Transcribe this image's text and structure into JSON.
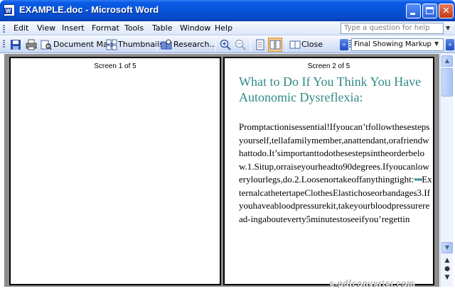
{
  "window": {
    "title": "EXAMPLE.doc - Microsoft Word",
    "app_icon_letter": "W",
    "controls": [
      "minimize",
      "maximize",
      "close"
    ]
  },
  "menu": {
    "items": [
      "Edit",
      "View",
      "Insert",
      "Format",
      "Tools",
      "Table",
      "Window",
      "Help"
    ],
    "help_placeholder": "Type a question for help"
  },
  "toolbar": {
    "document_map": "Document Map",
    "thumbnails": "Thumbnails",
    "research": "Research...",
    "close": "Close",
    "markup_mode": "Final Showing Markup"
  },
  "pages": {
    "left_label": "Screen 1 of 5",
    "right_label": "Screen 2 of 5"
  },
  "document": {
    "heading_line1": "What to Do If You Think You Have",
    "heading_line2": "Autonomic Dysreflexia:",
    "body_part1": "Promptactionisessential!Ifyoucan’tfollowthesestepsyourself,tellafamilymember,anattendant,orafriendwhattodo.It’simportanttodothesestepsintheorderbelow.1.Situp,orraiseyourheadto90degrees.Ifyoucanlowerylourlegs,do.2.Loosenortakeoffanythingtight:",
    "bullets": "▪▪▪",
    "body_part2": "ExternalcathetertapeClothesElastichoseorbandages3.Ifyouhaveabloodpressurekit,takeyourbloodpressureread-ingabouteverty5minutestoseeifyou’regettin"
  },
  "watermark": "e-pdfconverter.com",
  "colors": {
    "titlebar": "#0754d8",
    "heading": "#2f8a85",
    "workspace": "#8c8c8c"
  }
}
